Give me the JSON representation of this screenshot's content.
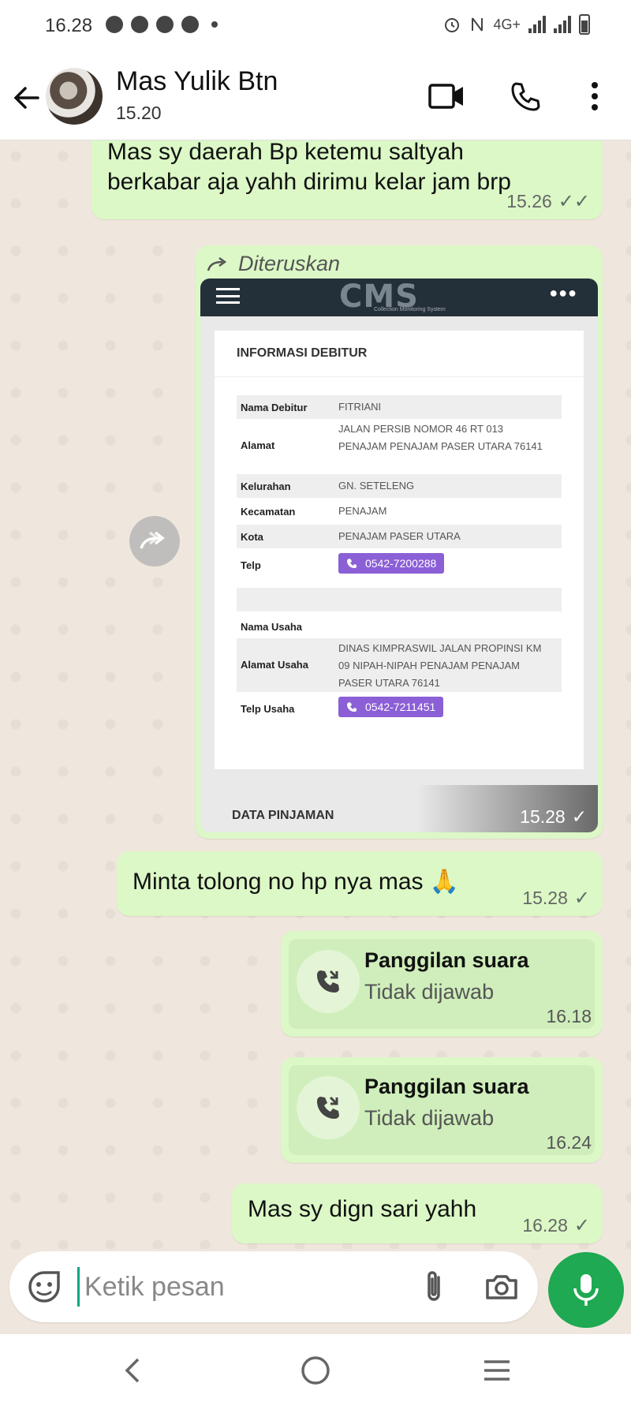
{
  "status_bar": {
    "time": "16.28",
    "network": "4G+"
  },
  "header": {
    "contact_name": "Mas Yulik Btn",
    "last_seen": "15.20"
  },
  "messages": {
    "m1": {
      "text_line1": "Mas sy daerah Bp ketemu saltyah",
      "text_line2": "berkabar aja yahh dirimu kelar jam brp",
      "time": "15.26",
      "status": "✓✓"
    },
    "forwarded": {
      "label": "Diteruskan",
      "time": "15.28",
      "status": "✓",
      "screenshot": {
        "logo": "CMS",
        "logo_sub": "Collection Monitoring System",
        "card_title": "INFORMASI DEBITUR",
        "rows": [
          {
            "label": "Nama Debitur",
            "value": "FITRIANI"
          },
          {
            "label": "Alamat",
            "value": "JALAN PERSIB NOMOR 46 RT 013 PENAJAM PENAJAM PASER UTARA 76141"
          },
          {
            "label": "Kelurahan",
            "value": "GN. SETELENG"
          },
          {
            "label": "Kecamatan",
            "value": "PENAJAM"
          },
          {
            "label": "Kota",
            "value": "PENAJAM PASER UTARA"
          },
          {
            "label": "Telp",
            "value": "0542-7200288"
          },
          {
            "label": "Nama Usaha",
            "value": ""
          },
          {
            "label": "Alamat Usaha",
            "value": "DINAS KIMPRASWIL JALAN PROPINSI KM 09 NIPAH-NIPAH PENAJAM PENAJAM PASER UTARA 76141"
          },
          {
            "label": "Telp Usaha",
            "value": "0542-7211451"
          }
        ],
        "section2": "DATA PINJAMAN"
      }
    },
    "m2": {
      "text": "Minta tolong no hp nya mas 🙏",
      "time": "15.28",
      "status": "✓"
    },
    "call1": {
      "title": "Panggilan suara",
      "subtitle": "Tidak dijawab",
      "time": "16.18"
    },
    "call2": {
      "title": "Panggilan suara",
      "subtitle": "Tidak dijawab",
      "time": "16.24"
    },
    "m3": {
      "text": "Mas sy dign sari yahh",
      "time": "16.28",
      "status": "✓"
    }
  },
  "input": {
    "placeholder": "Ketik pesan",
    "value": ""
  },
  "icons": {
    "accent": "#1ea952",
    "bubble": "#dbf8c6"
  }
}
